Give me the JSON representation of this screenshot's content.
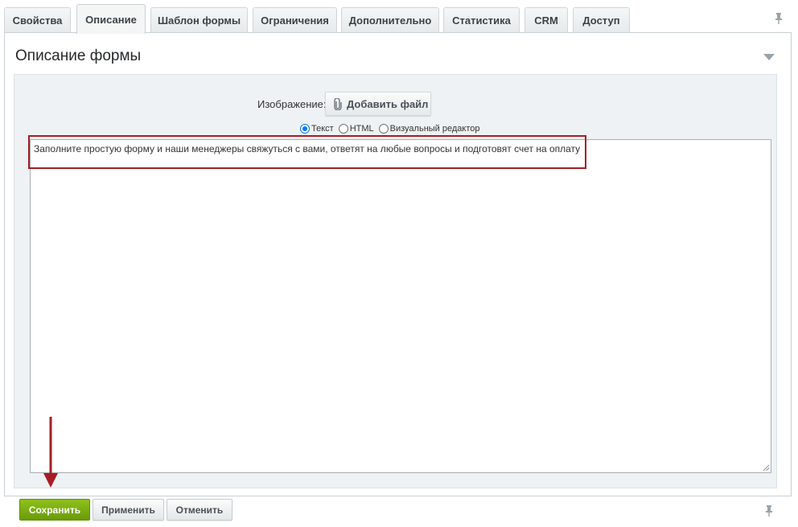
{
  "tabs": [
    {
      "label": "Свойства",
      "active": false
    },
    {
      "label": "Описание",
      "active": true
    },
    {
      "label": "Шаблон формы",
      "active": false
    },
    {
      "label": "Ограничения",
      "active": false
    },
    {
      "label": "Дополнительно",
      "active": false
    },
    {
      "label": "Статистика",
      "active": false
    },
    {
      "label": "CRM",
      "active": false
    },
    {
      "label": "Доступ",
      "active": false
    }
  ],
  "panel": {
    "title": "Описание формы"
  },
  "image_field": {
    "label": "Изображение:",
    "button_label": "Добавить файл"
  },
  "modes": {
    "selected": "Текст",
    "options": [
      "Текст",
      "HTML",
      "Визуальный редактор"
    ]
  },
  "editor": {
    "value": "Заполните простую форму и наши менеджеры свяжуться с вами, ответят на любые вопросы и подготовят счет на оплату"
  },
  "buttons": {
    "save": "Сохранить",
    "apply": "Применить",
    "cancel": "Отменить"
  },
  "colors": {
    "save_button": "#7aaf10",
    "annotation": "#a71d24",
    "radio_accent": "#0075ff"
  },
  "icons": [
    "pin-icon",
    "paperclip-icon",
    "collapse-arrow-icon",
    "resize-grip-icon",
    "annotation-arrow-icon"
  ]
}
